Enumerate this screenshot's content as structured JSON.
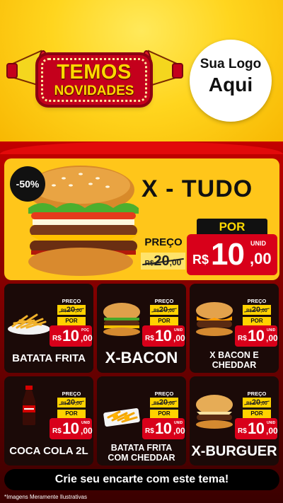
{
  "header": {
    "banner_line1": "TEMOS",
    "banner_line2": "NOVIDADES",
    "logo_line1": "Sua Logo",
    "logo_line2": "Aqui"
  },
  "featured": {
    "discount": "-50%",
    "name": "X - TUDO",
    "preco_label": "PREÇO",
    "old_currency": "R$",
    "old_int": "20",
    "old_dec": ",00",
    "por_label": "POR",
    "currency": "R$",
    "price_int": "10",
    "price_dec": ",00",
    "unit": "UNID"
  },
  "products": [
    {
      "name": "BATATA FRITA",
      "preco_label": "PREÇO",
      "old_currency": "R$",
      "old_int": "20",
      "old_dec": ",00",
      "por_label": "POR",
      "currency": "R$",
      "price_int": "10",
      "price_dec": ",00",
      "unit": "POÇ",
      "image": "fries"
    },
    {
      "name": "X-BACON",
      "preco_label": "PREÇO",
      "old_currency": "R$",
      "old_int": "20",
      "old_dec": ",00",
      "por_label": "POR",
      "currency": "R$",
      "price_int": "10",
      "price_dec": ",00",
      "unit": "UNID",
      "image": "burger"
    },
    {
      "name": "X BACON E CHEDDAR",
      "preco_label": "PREÇO",
      "old_currency": "R$",
      "old_int": "20",
      "old_dec": ",00",
      "por_label": "POR",
      "currency": "R$",
      "price_int": "10",
      "price_dec": ",00",
      "unit": "UNID",
      "image": "cheddar-burger"
    },
    {
      "name": "COCA COLA 2L",
      "preco_label": "PREÇO",
      "old_currency": "R$",
      "old_int": "20",
      "old_dec": ",00",
      "por_label": "POR",
      "currency": "R$",
      "price_int": "10",
      "price_dec": ",00",
      "unit": "UNID",
      "image": "soda-bottle"
    },
    {
      "name": "BATATA FRITA COM CHEDDAR",
      "preco_label": "PREÇO",
      "old_currency": "R$",
      "old_int": "20",
      "old_dec": ",00",
      "por_label": "POR",
      "currency": "R$",
      "price_int": "10",
      "price_dec": ",00",
      "unit": "UNID",
      "image": "cheddar-fries"
    },
    {
      "name": "X-BURGUER",
      "preco_label": "PREÇO",
      "old_currency": "R$",
      "old_int": "20",
      "old_dec": ",00",
      "por_label": "POR",
      "currency": "R$",
      "price_int": "10",
      "price_dec": ",00",
      "unit": "UNID",
      "image": "cheeseburger"
    }
  ],
  "cta": "Crie seu encarte com este tema!",
  "disclaimer": "*Imagens Meramente Ilustrativas",
  "colors": {
    "accent_red": "#d8001a",
    "accent_yellow": "#ffd200",
    "card_bg": "#1b0a08"
  }
}
